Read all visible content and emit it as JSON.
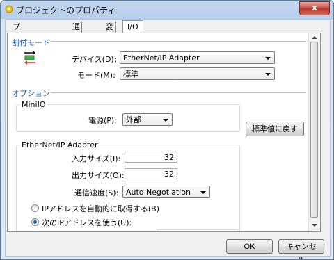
{
  "window": {
    "title": "プロジェクトのプロパティ",
    "close_glyph": "x"
  },
  "tabs": [
    "プロジェクト情報",
    "通信設定",
    "変数",
    "I/O"
  ],
  "active_tab": "I/O",
  "assignment": {
    "heading": "割付モード",
    "device_label": "デバイス(D):",
    "device_value": "EtherNet/IP Adapter",
    "mode_label": "モード(M):",
    "mode_value": "標準"
  },
  "options": {
    "heading": "オプション",
    "restore_button": "標準値に戻す",
    "miniio": {
      "title": "MiniIO",
      "power_label": "電源(P):",
      "power_value": "外部"
    },
    "ethernet": {
      "title": "EtherNet/IP Adapter",
      "input_size_label": "入力サイズ(I):",
      "input_size_value": "32",
      "output_size_label": "出力サイズ(O):",
      "output_size_value": "32",
      "speed_label": "通信速度(S):",
      "speed_value": "Auto Negotiation",
      "radio_auto": "IPアドレスを自動的に取得する(B)",
      "radio_manual": "次のIPアドレスを使う(U):",
      "selected_radio": "manual"
    }
  },
  "footer": {
    "ok": "OK",
    "cancel": "キャンセル"
  },
  "colors": {
    "section_heading": "#1e5aa8",
    "radio_dot": "#1a5c9e"
  }
}
